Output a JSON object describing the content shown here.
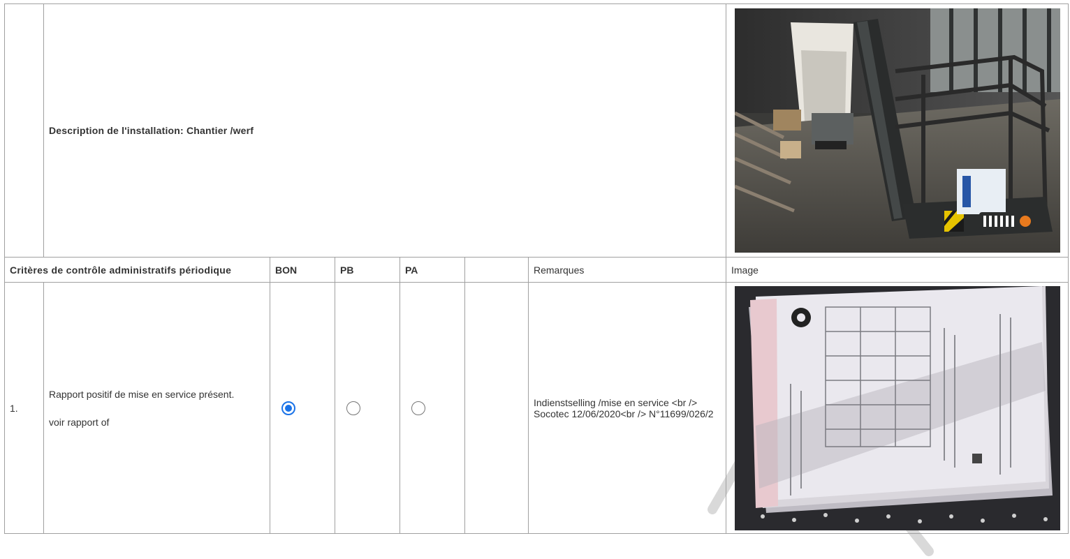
{
  "installation": {
    "description": "Description de l'installation: Chantier /werf",
    "photo_icon": "aerial-work-platform-photo"
  },
  "header": {
    "criteria": "Critères de contrôle administratifs périodique",
    "bon": "BON",
    "pb": "PB",
    "pa": "PA",
    "empty": "",
    "remarks": "Remarques",
    "image": "Image"
  },
  "items": [
    {
      "number": "1.",
      "text": "Rapport positif de mise en service présent.",
      "note": "voir rapport of",
      "selected": "BON",
      "remarks": "Indienstselling /mise en service <br /> Socotec 12/06/2020<br /> N°11699/026/2",
      "photo_icon": "document-stack-photo"
    }
  ],
  "colors": {
    "border": "#a0a0a0",
    "radio_checked": "#1a73e8",
    "text": "#333333"
  }
}
